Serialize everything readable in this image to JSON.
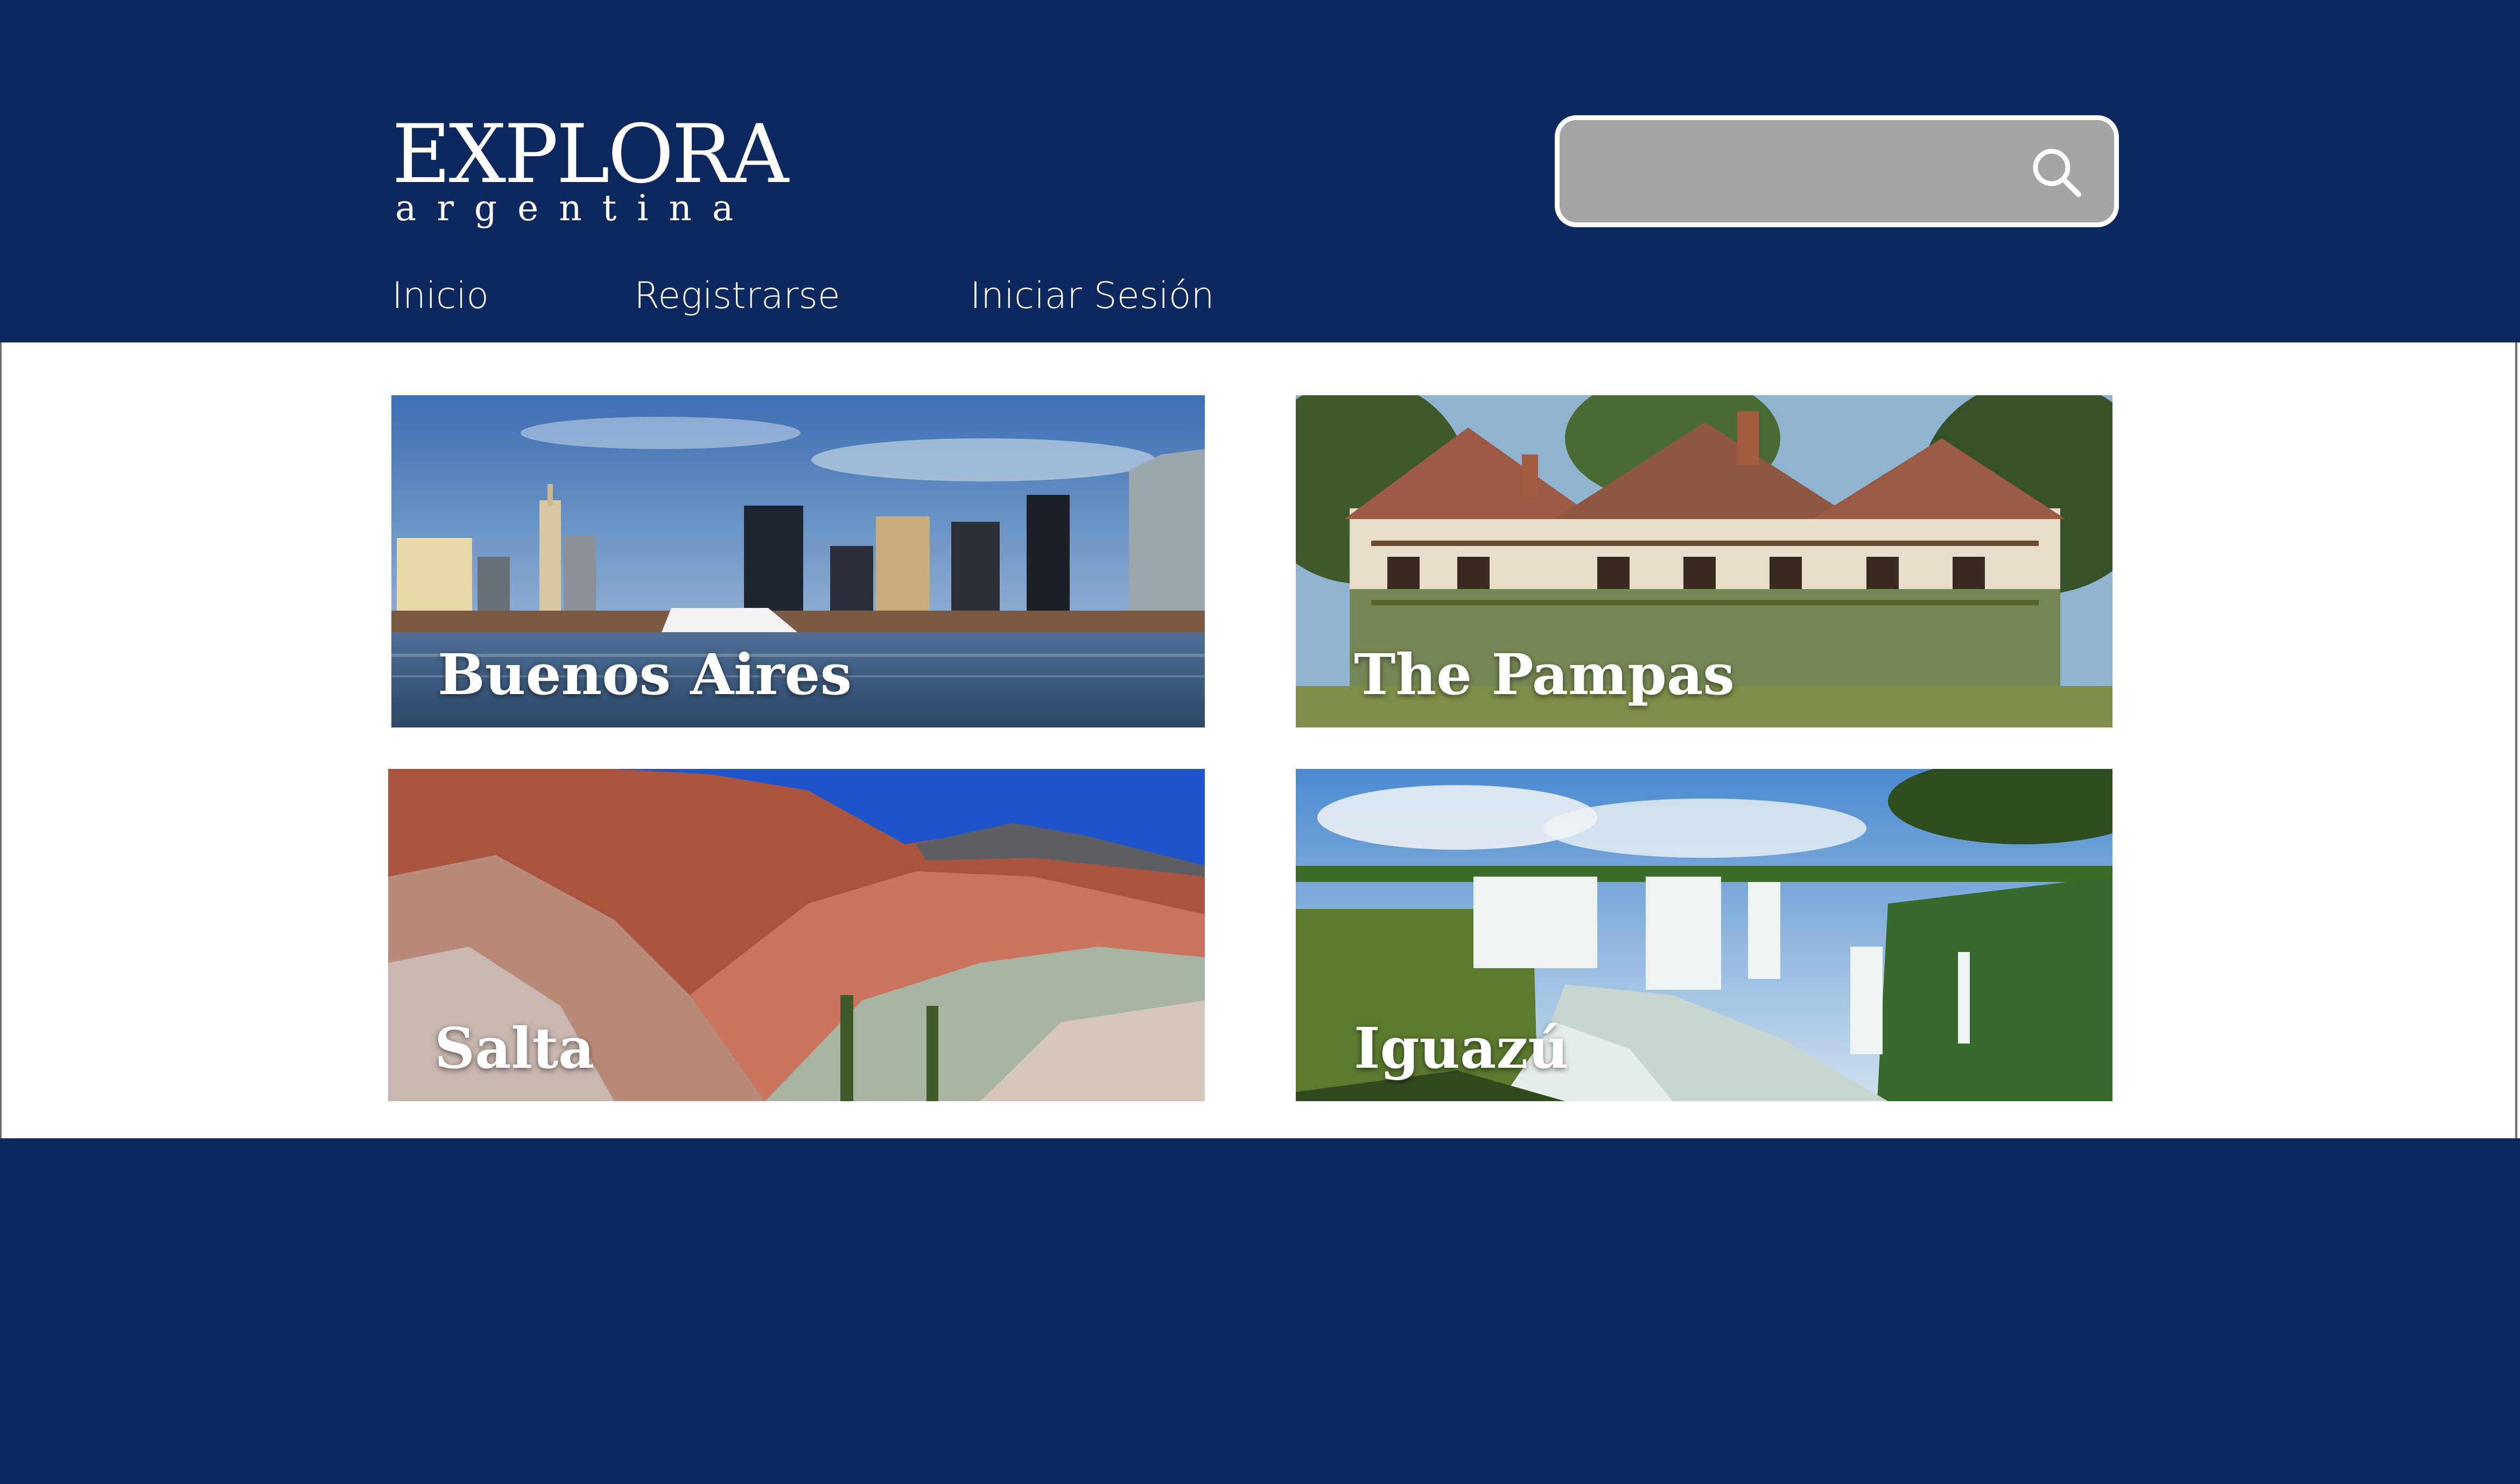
{
  "brand": {
    "name": "EXPLORA",
    "tagline": "argentina"
  },
  "search": {
    "placeholder": "",
    "icon": "search-icon"
  },
  "nav": {
    "items": [
      {
        "label": "Inicio"
      },
      {
        "label": "Registrarse"
      },
      {
        "label": "Iniciar Sesión"
      }
    ]
  },
  "destinations": [
    {
      "label": "Buenos Aires",
      "image": "city-skyline-image"
    },
    {
      "label": "The Pampas",
      "image": "estancia-manor-image"
    },
    {
      "label": "Salta",
      "image": "colored-mountains-image"
    },
    {
      "label": "Iguazú",
      "image": "waterfalls-image"
    }
  ],
  "colors": {
    "header_bg": "#0e285f",
    "footer_bg": "#0e285f",
    "search_bg": "#a4a4a4",
    "text_light": "#ffffff"
  }
}
